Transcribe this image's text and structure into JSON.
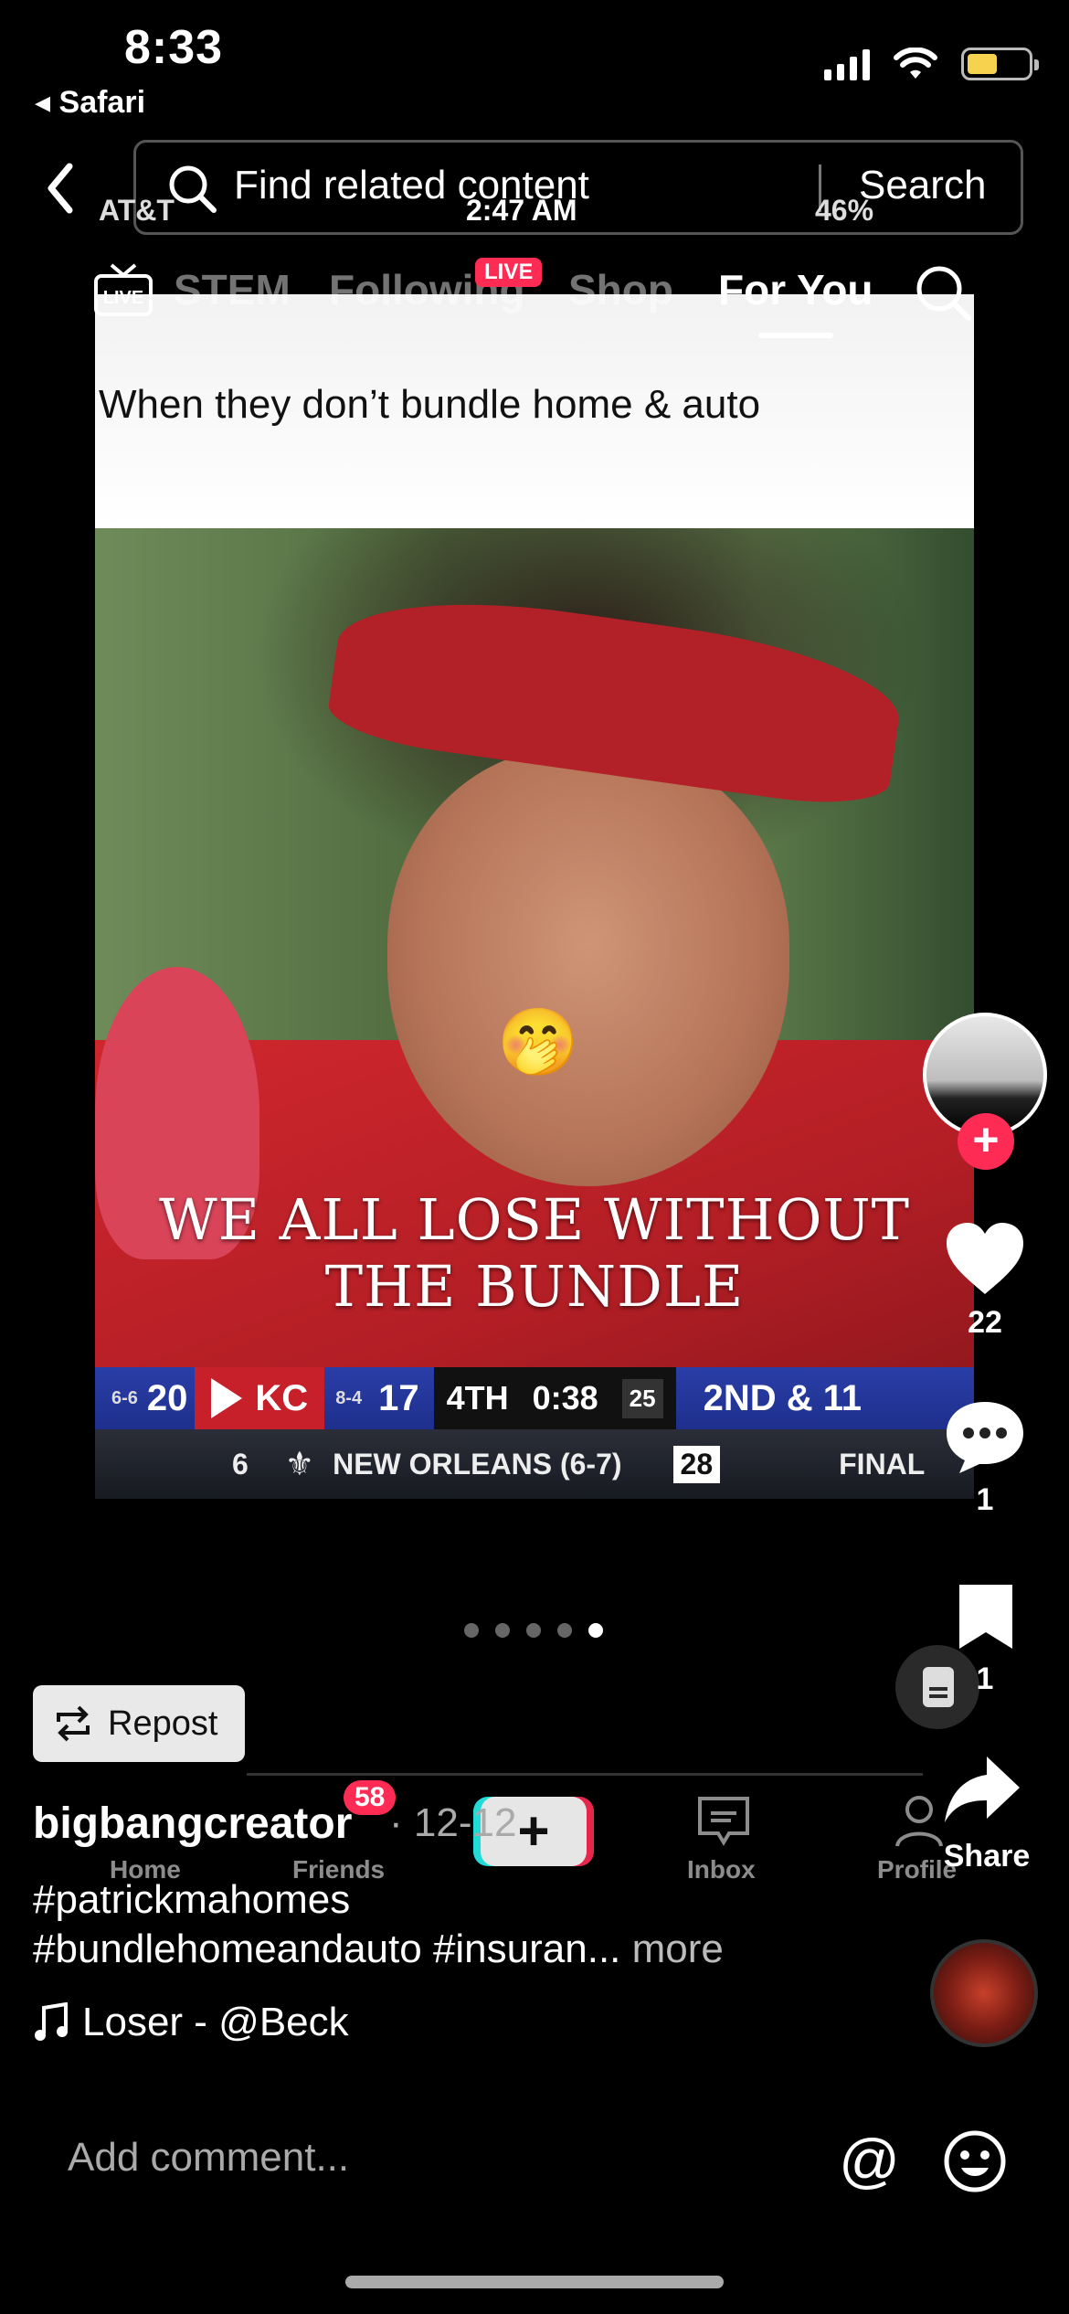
{
  "status_bar": {
    "time": "8:33",
    "back_app": "◂ Safari"
  },
  "search": {
    "placeholder": "Find related content",
    "button": "Search"
  },
  "embedded_status": {
    "carrier": "AT&T",
    "time": "2:47 AM",
    "battery": "46%"
  },
  "top_nav": {
    "tabs": [
      "STEM",
      "Following",
      "Shop",
      "For You"
    ],
    "live_badge": "LIVE",
    "active_tab": "For You"
  },
  "post": {
    "caption_header": "When they don’t bundle home & auto",
    "overlay_text": "We all lose without the bundle",
    "emoji": "🤭",
    "scoreboard": {
      "away_record": "6-6",
      "away_score": "20",
      "home_abbr": "KC",
      "home_record": "8-4",
      "home_score": "17",
      "quarter": "4TH",
      "clock": "0:38",
      "play_clock": "25",
      "down": "2ND & 11",
      "other_score": "6",
      "other_team": "NEW ORLEANS (6-7)",
      "other_box": "28",
      "status": "FINAL"
    },
    "carousel_total": 5,
    "carousel_active": 5
  },
  "rail": {
    "likes": "22",
    "comments": "1",
    "saves": "1",
    "share_label": "Share"
  },
  "repost_label": "Repost",
  "embedded_bottom_nav": {
    "home": "Home",
    "friends": "Friends",
    "friends_badge": "58",
    "inbox": "Inbox",
    "profile": "Profile"
  },
  "caption": {
    "username": "bigbangcreator",
    "date": "· 12-12",
    "hashtags_line1": "#patrickmahomes",
    "hashtags_line2": "#bundlehomeandauto #insuran...",
    "more": "more",
    "sound": "Loser - @Beck"
  },
  "comment_bar": {
    "placeholder": "Add comment..."
  },
  "colors": {
    "accent": "#fe2c55",
    "cyan": "#25f4ee"
  }
}
